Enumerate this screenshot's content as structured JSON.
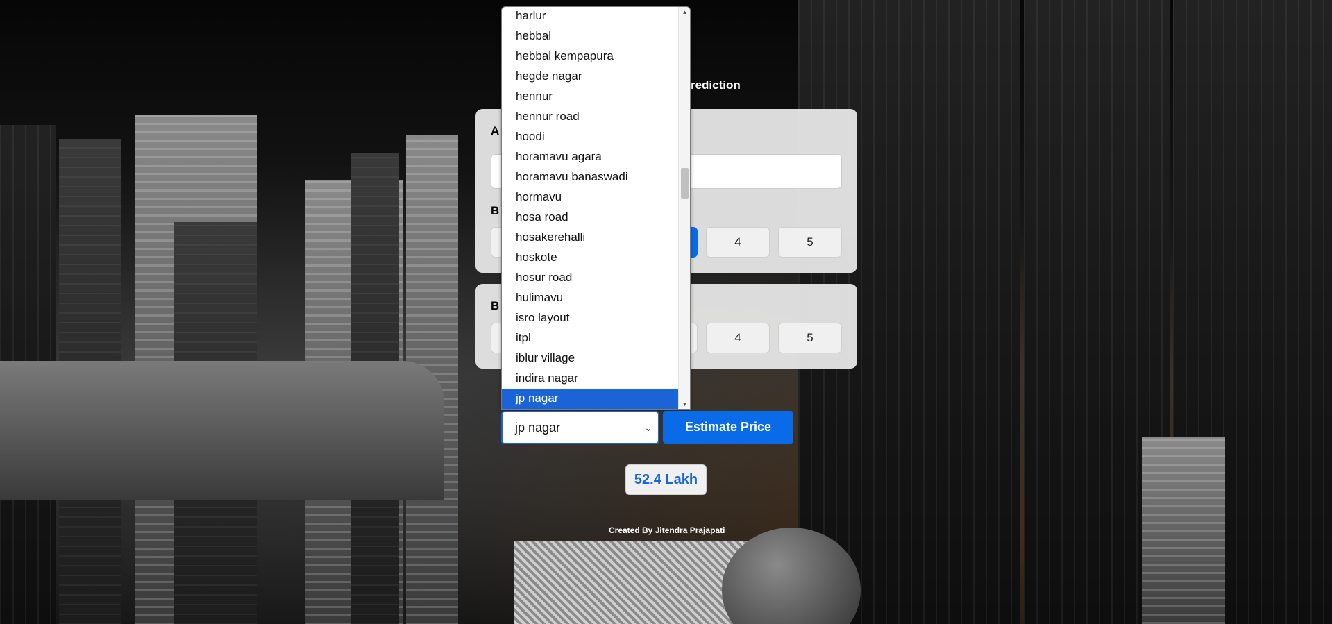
{
  "header": {
    "title_visible": "ce Prediction"
  },
  "card_1": {
    "label_area": "A",
    "label_bhk": "B",
    "bhk_options": [
      "4",
      "5"
    ]
  },
  "card_2": {
    "label_bath": "B",
    "bath_options": [
      "4",
      "5"
    ]
  },
  "dropdown": {
    "items": [
      "harlur",
      "hebbal",
      "hebbal kempapura",
      "hegde nagar",
      "hennur",
      "hennur road",
      "hoodi",
      "horamavu agara",
      "horamavu banaswadi",
      "hormavu",
      "hosa road",
      "hosakerehalli",
      "hoskote",
      "hosur road",
      "hulimavu",
      "isro layout",
      "itpl",
      "iblur village",
      "indira nagar",
      "jp nagar"
    ],
    "selected": "jp nagar"
  },
  "location_select": {
    "value": "jp nagar"
  },
  "estimate_button": {
    "label": "Estimate Price"
  },
  "result": {
    "text": "52.4 Lakh"
  },
  "footer": {
    "credit": "Created By Jitendra Prajapati"
  },
  "colors": {
    "accent": "#0a6be8",
    "selected_item": "#1a64d8"
  }
}
